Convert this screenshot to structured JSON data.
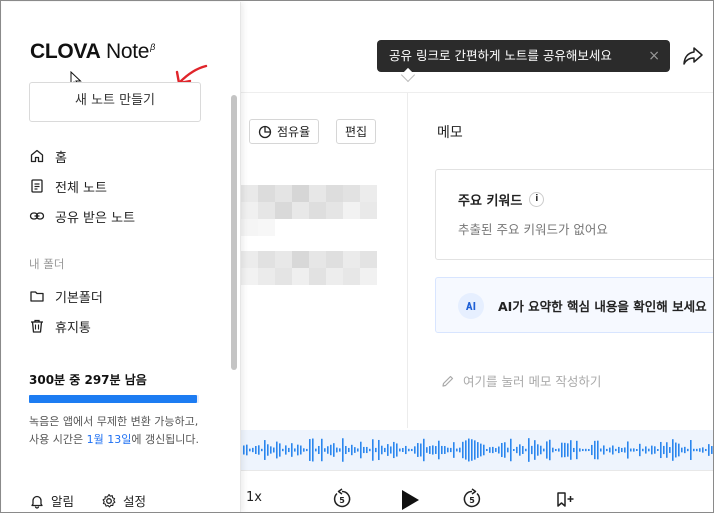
{
  "sidebar": {
    "logo_main": "CLOVA",
    "logo_sub": "Note",
    "logo_beta": "β",
    "new_note_label": "새 노트 만들기",
    "nav": [
      {
        "label": "홈",
        "icon": "home-icon"
      },
      {
        "label": "전체 노트",
        "icon": "document-icon"
      },
      {
        "label": "공유 받은 노트",
        "icon": "link-icon"
      }
    ],
    "folder_section_label": "내 폴더",
    "folders": [
      {
        "label": "기본폴더",
        "icon": "folder-icon"
      },
      {
        "label": "휴지통",
        "icon": "trash-icon"
      }
    ],
    "quota": {
      "title": "300분 중 297분 남음",
      "remaining_fraction": 0.99,
      "desc_prefix": "녹음은 앱에서 무제한 변환 가능하고, 사용 시간은 ",
      "desc_link": "1월 13일",
      "desc_suffix": "에 갱신됩니다."
    },
    "bottom": {
      "alarm_label": "알림",
      "settings_label": "설정"
    }
  },
  "header": {
    "tooltip_text": "공유 링크로 간편하게 노트를 공유해보세요",
    "tooltip_close": "×"
  },
  "toolbar": {
    "share_ratio_label": "점유율",
    "edit_label": "편집"
  },
  "memo": {
    "title": "메모",
    "keyword_title": "주요 키워드",
    "keyword_info": "i",
    "keyword_empty": "추출된 주요 키워드가 없어요",
    "ai_badge": "AI",
    "ai_text": "AI가 요약한 핵심 내용을 확인해 보세요",
    "input_placeholder": "여기를 눌러 메모 작성하기"
  },
  "player": {
    "speed": "1x",
    "rewind_seconds": "5",
    "forward_seconds": "5"
  },
  "colors": {
    "accent": "#1d7cf2",
    "tooltip_bg": "#2b2b2b",
    "annotation_red": "#e0252b"
  }
}
